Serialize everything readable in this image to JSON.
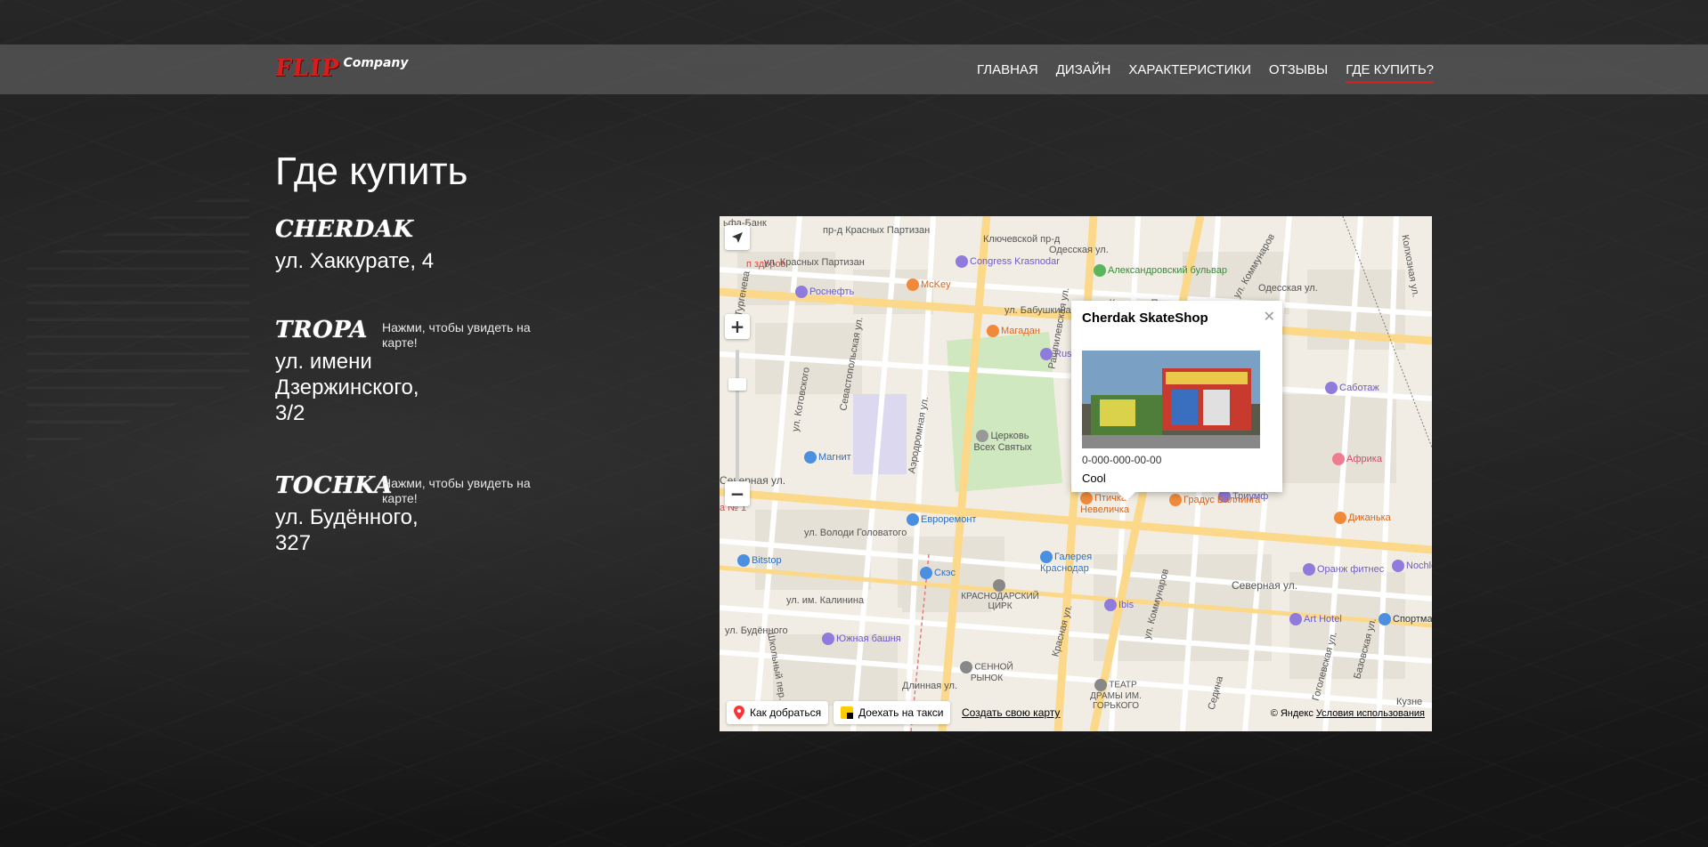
{
  "header": {
    "logo": {
      "flip": "FLIP",
      "company": "Company"
    },
    "nav": [
      {
        "label": "ГЛАВНАЯ"
      },
      {
        "label": "ДИЗАЙН"
      },
      {
        "label": "ХАРАКТЕРИСТИКИ"
      },
      {
        "label": "ОТЗЫВЫ"
      },
      {
        "label": "ГДЕ КУПИТЬ?",
        "active": true
      }
    ],
    "accent_color": "#d41f1f"
  },
  "main": {
    "title": "Где купить",
    "shops": [
      {
        "name": "CHERDAK",
        "address": "ул. Хаккурате, 4",
        "hint": ""
      },
      {
        "name": "TROPA",
        "address": "ул. имени Дзержинского, 3/2",
        "hint": "Нажми, чтобы увидеть на карте!"
      },
      {
        "name": "TOCHKA",
        "address": "ул. Будённого, 327",
        "hint": "Нажми, чтобы увидеть на карте!"
      }
    ]
  },
  "map": {
    "balloon": {
      "title": "Cherdak SkateShop",
      "phone": "0-000-000-00-00",
      "description": "Cool",
      "close_icon": "close-icon"
    },
    "street_labels": [
      "пр-д Красных Партизан",
      "ул. Красных Партизан",
      "ул. Бабушкина",
      "ул. Красных Парти",
      "Ключевской пр-д",
      "Одесская ул.",
      "Одесская ул.",
      "Колхозная ул.",
      "ул. Коммунаров",
      "ул. Котовского",
      "Севастопольская ул.",
      "Аэродромная ул.",
      "Рашпилевская ул.",
      "Северная ул.",
      "Северная ул.",
      "ул. Володи Головатого",
      "ул. им. Калинина",
      "ул. Будённого",
      "Школьный пер.",
      "Длинная ул.",
      "Красная ул.",
      "ул. Коммунаров",
      "Седина",
      "Гоголевская ул.",
      "Базовская ул.",
      "Кузне",
      "ул. Тургенева",
      "Красная",
      "ьфа-Банк",
      "п здоров",
      "а № 1"
    ],
    "pois": [
      {
        "name": "Congress Krasnodar",
        "icon": "hotel-icon",
        "color": "#8f7bdb"
      },
      {
        "name": "Александровский бульвар",
        "icon": "park-icon",
        "color": "#5bb55b"
      },
      {
        "name": "Роснефть",
        "icon": "fuel-icon",
        "color": "#8f7bdb"
      },
      {
        "name": "McKey",
        "icon": "restaurant-icon",
        "color": "#f08a3a"
      },
      {
        "name": "Магадан",
        "icon": "restaurant-icon",
        "color": "#f08a3a"
      },
      {
        "name": "Rusoil",
        "icon": "fuel-icon",
        "color": "#8f7bdb"
      },
      {
        "name": "Саботаж",
        "icon": "bar-icon",
        "color": "#8f7bdb"
      },
      {
        "name": "Магнит",
        "icon": "shop-icon",
        "color": "#4a8fe0"
      },
      {
        "name": "Церковь Всех Святых",
        "icon": "church-icon",
        "color": "#999999"
      },
      {
        "name": "Африка",
        "icon": "cafe-icon",
        "color": "#f07c92"
      },
      {
        "name": "Триумф",
        "icon": "hotel-icon",
        "color": "#8f7bdb"
      },
      {
        "name": "Птичка-Невеличка",
        "icon": "restaurant-icon",
        "color": "#f08a3a"
      },
      {
        "name": "Градус Баллинга",
        "icon": "restaurant-icon",
        "color": "#f08a3a"
      },
      {
        "name": "Диканька",
        "icon": "restaurant-icon",
        "color": "#f08a3a"
      },
      {
        "name": "Евроремонт",
        "icon": "shop-icon",
        "color": "#4a8fe0"
      },
      {
        "name": "Bitstop",
        "icon": "shop-icon",
        "color": "#4a8fe0"
      },
      {
        "name": "Скэс",
        "icon": "shop-icon",
        "color": "#4a8fe0"
      },
      {
        "name": "Галерея Краснодар",
        "icon": "shop-icon",
        "color": "#4a8fe0"
      },
      {
        "name": "Оранж фитнес",
        "icon": "fitness-icon",
        "color": "#8f7bdb"
      },
      {
        "name": "Nochle",
        "icon": "hotel-icon",
        "color": "#8f7bdb"
      },
      {
        "name": "КРАСНОДАРСКИЙ ЦИРК",
        "icon": "circus-icon",
        "color": "#888888"
      },
      {
        "name": "Ibis",
        "icon": "hotel-icon",
        "color": "#8f7bdb"
      },
      {
        "name": "Art Hotel",
        "icon": "hotel-icon",
        "color": "#8f7bdb"
      },
      {
        "name": "Спортмастер",
        "icon": "sport-icon",
        "color": "#4a8fe0"
      },
      {
        "name": "Южная башня",
        "icon": "hotel-icon",
        "color": "#8f7bdb"
      },
      {
        "name": "СЕННОЙ РЫНОК",
        "icon": "market-icon",
        "color": "#888888"
      },
      {
        "name": "ТЕАТР ДРАМЫ ИМ. ГОРЬКОГО",
        "icon": "theatre-icon",
        "color": "#888888"
      }
    ],
    "buttons": {
      "route": "Как добраться",
      "taxi": "Доехать на такси",
      "create": "Создать свою карту"
    },
    "copyright": {
      "text": "© Яндекс",
      "terms": "Условия использования"
    }
  }
}
